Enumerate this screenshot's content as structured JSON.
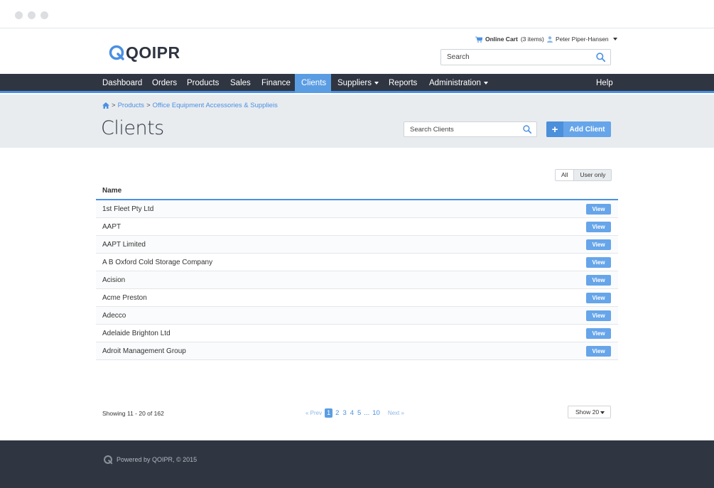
{
  "header": {
    "logo_text": "QOIPR",
    "cart_label": "Online Cart",
    "cart_count": "(3 items)",
    "user_name": "Peter Piper-Hansen",
    "search_placeholder": "Search"
  },
  "nav": {
    "items": [
      {
        "label": "Dashboard"
      },
      {
        "label": "Orders"
      },
      {
        "label": "Products"
      },
      {
        "label": "Sales"
      },
      {
        "label": "Finance"
      },
      {
        "label": "Clients"
      },
      {
        "label": "Suppliers"
      },
      {
        "label": "Reports"
      },
      {
        "label": "Administration"
      }
    ],
    "help": "Help"
  },
  "breadcrumb": {
    "sep1": ">",
    "level1": "Products",
    "sep2": ">",
    "level2": "Office Equipment Accessories & Supplieis"
  },
  "page": {
    "title": "Clients",
    "search_placeholder": "Search Clients",
    "add_icon": "+",
    "add_label": "Add Client"
  },
  "filter": {
    "all": "All",
    "user_only": "User only"
  },
  "table": {
    "header": "Name",
    "view_label": "View",
    "rows": [
      "1st Fleet Pty Ltd",
      "AAPT",
      "AAPT Limited",
      "A B Oxford Cold Storage Company",
      "Acision",
      "Acme Preston",
      "Adecco",
      "Adelaide Brighton Ltd",
      "Adroit Management Group"
    ]
  },
  "pagination": {
    "showing": "Showing 11 - 20 of 162",
    "prev": "« Prev",
    "pages": [
      "1",
      "2",
      "3",
      "4",
      "5"
    ],
    "ellipsis": "...",
    "last": "10",
    "next": "Next »",
    "show_count": "Show 20"
  },
  "footer": {
    "text": "Powered by QOIPR, © 2015"
  },
  "colors": {
    "accent": "#4a90e2",
    "nav_bg": "#2f3541",
    "button_blue": "#66a5ea",
    "subheader_bg": "#e9ecef"
  }
}
